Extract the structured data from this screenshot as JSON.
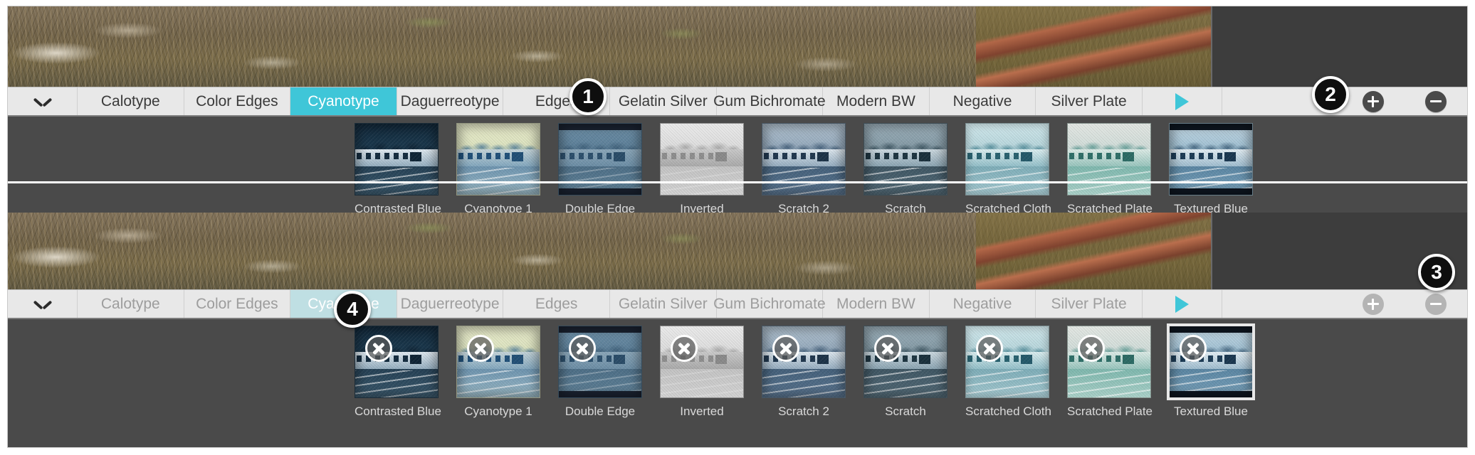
{
  "app": {
    "accent_color": "#3fc6d8",
    "accent_color_disabled": "#bfdfe3",
    "tray_background": "#4a4a4a",
    "toolbar_background": "#e8e8e8"
  },
  "toolbar": {
    "chevron_icon": "chevron-down-icon",
    "play_icon": "play-triangle-icon",
    "add_icon": "plus-circle-icon",
    "remove_icon": "minus-circle-icon",
    "tabs": [
      {
        "label": "Calotype",
        "active": false
      },
      {
        "label": "Color Edges",
        "active": false
      },
      {
        "label": "Cyanotype",
        "active": true
      },
      {
        "label": "Daguerreotype",
        "active": false
      },
      {
        "label": "Edges",
        "active": false
      },
      {
        "label": "Gelatin Silver",
        "active": false
      },
      {
        "label": "Gum Bichromate",
        "active": false
      },
      {
        "label": "Modern BW",
        "active": false
      },
      {
        "label": "Negative",
        "active": false
      },
      {
        "label": "Silver Plate",
        "active": false
      }
    ]
  },
  "presets": [
    {
      "label": "Contrasted Blue",
      "delete_icon": "close-circle-icon"
    },
    {
      "label": "Cyanotype 1",
      "delete_icon": "close-circle-icon"
    },
    {
      "label": "Double Edge",
      "delete_icon": "close-circle-icon"
    },
    {
      "label": "Inverted",
      "delete_icon": "close-circle-icon"
    },
    {
      "label": "Scratch 2",
      "delete_icon": "close-circle-icon"
    },
    {
      "label": "Scratch",
      "delete_icon": "close-circle-icon"
    },
    {
      "label": "Scratched Cloth",
      "delete_icon": "close-circle-icon"
    },
    {
      "label": "Scratched Plate",
      "delete_icon": "close-circle-icon"
    },
    {
      "label": "Textured Blue",
      "delete_icon": "close-circle-icon"
    }
  ],
  "callouts": [
    {
      "number": "1"
    },
    {
      "number": "2"
    },
    {
      "number": "3"
    },
    {
      "number": "4"
    }
  ]
}
